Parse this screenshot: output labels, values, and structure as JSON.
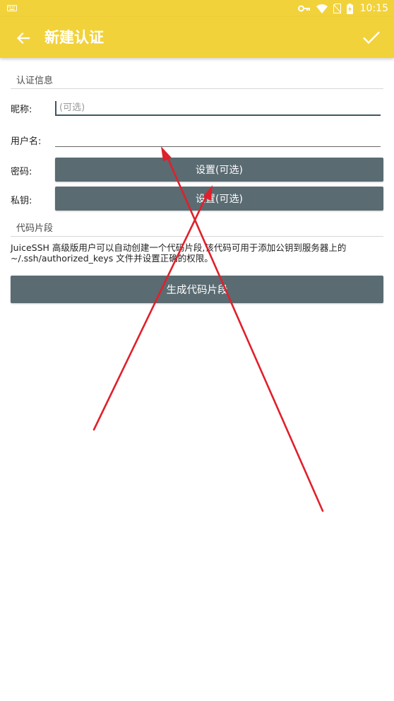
{
  "status_bar": {
    "time": "10:15",
    "icons": [
      "keyboard-icon",
      "key-icon",
      "wifi-icon",
      "no-sim-icon",
      "battery-charging-icon"
    ]
  },
  "toolbar": {
    "title": "新建认证",
    "back_icon": "arrow-left-icon",
    "save_icon": "check-icon"
  },
  "identity_section": {
    "header": "认证信息",
    "nickname": {
      "label": "昵称:",
      "placeholder": "(可选)",
      "value": ""
    },
    "username": {
      "label": "用户名:",
      "placeholder": "",
      "value": ""
    },
    "password": {
      "label": "密码:",
      "button": "设置(可选)"
    },
    "private_key": {
      "label": "私钥:",
      "button": "设置(可选)"
    }
  },
  "snippet_section": {
    "header": "代码片段",
    "description_line1": "JuiceSSH 高级版用户可以自动创建一个代码片段,该代码可用于添加公钥到服务器上的",
    "description_line2": "~/.ssh/authorized_keys 文件并设置正确的权限。",
    "button": "生成代码片段"
  },
  "colors": {
    "toolbar_bg": "#f2d23a",
    "button_bg": "#5a6b72",
    "annotation_red": "#e0202a"
  }
}
